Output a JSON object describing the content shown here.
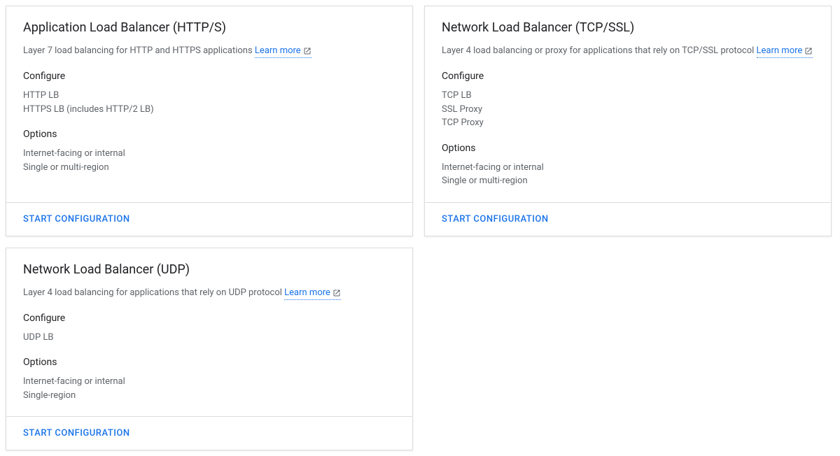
{
  "common": {
    "learn_more_label": "Learn more",
    "configure_heading": "Configure",
    "options_heading": "Options",
    "start_button_label": "START CONFIGURATION"
  },
  "cards": [
    {
      "title": "Application Load Balancer (HTTP/S)",
      "description": "Layer 7 load balancing for HTTP and HTTPS applications ",
      "configure_items": [
        "HTTP LB",
        "HTTPS LB (includes HTTP/2 LB)"
      ],
      "options_items": [
        "Internet-facing or internal",
        "Single or multi-region"
      ]
    },
    {
      "title": "Network Load Balancer (TCP/SSL)",
      "description": "Layer 4 load balancing or proxy for applications that rely on TCP/SSL protocol ",
      "configure_items": [
        "TCP LB",
        "SSL Proxy",
        "TCP Proxy"
      ],
      "options_items": [
        "Internet-facing or internal",
        "Single or multi-region"
      ]
    },
    {
      "title": "Network Load Balancer (UDP)",
      "description": "Layer 4 load balancing for applications that rely on UDP protocol ",
      "configure_items": [
        "UDP LB"
      ],
      "options_items": [
        "Internet-facing or internal",
        "Single-region"
      ]
    }
  ]
}
